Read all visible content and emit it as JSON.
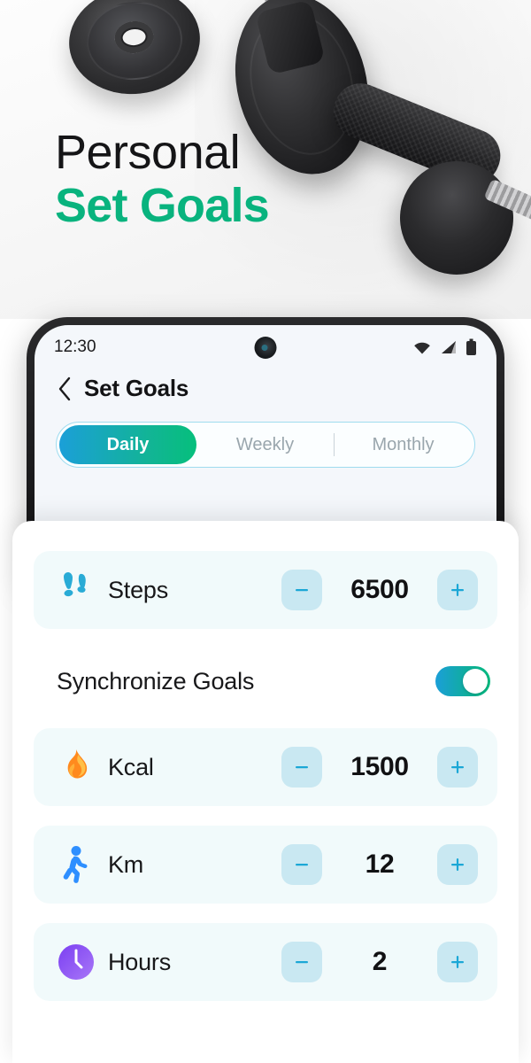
{
  "hero": {
    "headline_top": "Personal",
    "headline_bottom": "Set Goals",
    "accent_color": "#09b37e",
    "photo_subject": "dumbbell-and-weight-plates-photo"
  },
  "phone": {
    "status_bar": {
      "time": "12:30",
      "icons": [
        "wifi-icon",
        "cellular-signal-icon",
        "battery-icon"
      ],
      "camera": "front-camera-punch-hole"
    },
    "header": {
      "back_icon": "chevron-left-icon",
      "title": "Set Goals"
    },
    "tabs": {
      "items": [
        {
          "label": "Daily",
          "active": true
        },
        {
          "label": "Weekly",
          "active": false
        },
        {
          "label": "Monthly",
          "active": false
        }
      ],
      "active_gradient_from": "#1b9fd8",
      "active_gradient_to": "#06bf7c",
      "border_color": "#9fdcef",
      "inactive_text_color": "#9aa6ad"
    }
  },
  "sheet": {
    "row_background": "#f1fafb",
    "stepper_button_color": "#c9e8f2",
    "stepper_glyph_color": "#1ba7d6",
    "decrement_label": "−",
    "increment_label": "+",
    "sync": {
      "label": "Synchronize Goals",
      "toggle_state": "on",
      "toggle_gradient_from": "#1b9fd8",
      "toggle_gradient_to": "#06bd80"
    },
    "goals": [
      {
        "label": "Steps",
        "value": "6500",
        "icon": "footprints-icon",
        "icon_color": "#29abd6"
      },
      {
        "label": "Kcal",
        "value": "1500",
        "icon": "flame-icon",
        "icon_color": "#ff8a1e"
      },
      {
        "label": "Km",
        "value": "12",
        "icon": "running-person-icon",
        "icon_color": "#2e8fff"
      },
      {
        "label": "Hours",
        "value": "2",
        "icon": "clock-icon",
        "icon_color": "#7b3ff2"
      }
    ]
  }
}
